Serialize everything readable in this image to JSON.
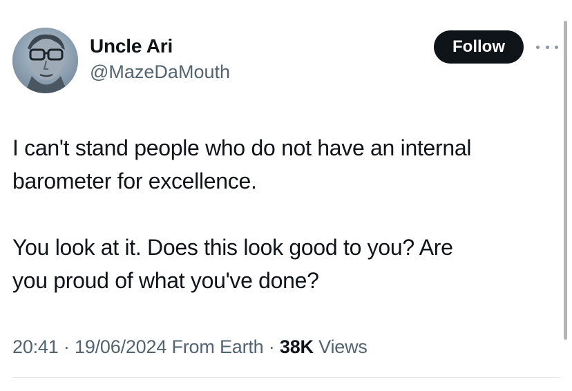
{
  "author": {
    "display_name": "Uncle Ari",
    "handle": "@MazeDaMouth",
    "avatar_icon": "avatar-portrait"
  },
  "actions": {
    "follow_label": "Follow",
    "more_icon": "more-horizontal-icon"
  },
  "tweet": {
    "paragraphs": [
      "I can't stand people who do not have an internal\nbarometer for excellence.",
      "You look at it. Does this look good to you? Are\nyou proud of what you've done?"
    ]
  },
  "meta": {
    "time": "20:41",
    "separator": "·",
    "date": "19/06/2024",
    "source": "From Earth",
    "views_count": "38K",
    "views_label": "Views"
  },
  "colors": {
    "text_primary": "#0f1419",
    "text_secondary": "#536471",
    "follow_bg": "#0f1419",
    "follow_text": "#ffffff"
  }
}
